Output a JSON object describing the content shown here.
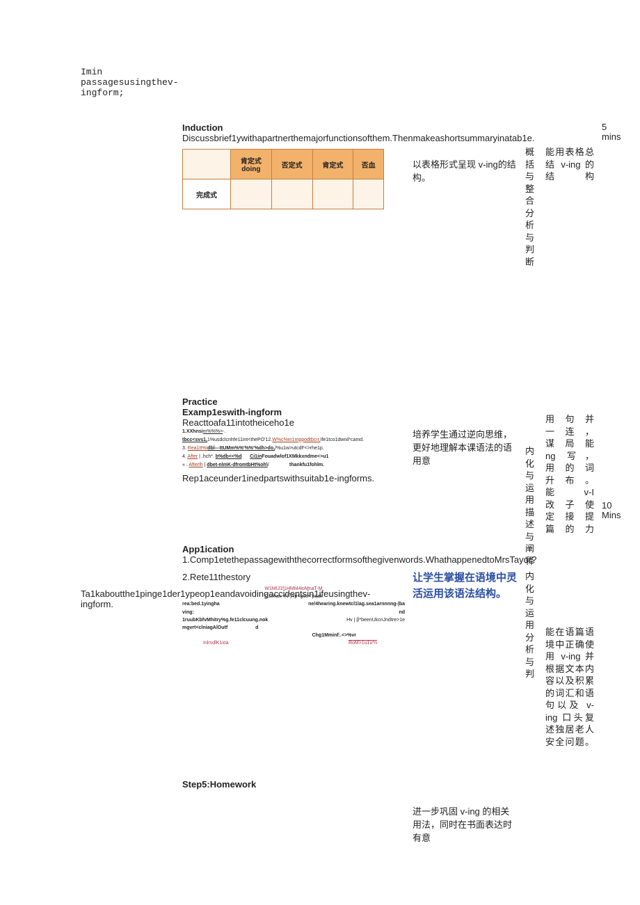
{
  "header": {
    "line1": "Imin",
    "line2": "passagesusingthev-",
    "line3": "ingform;"
  },
  "induction": {
    "title": "Induction",
    "body": "Discussbrief1ywithapartnerthemajorfunctionsofthem.Thenmakeashortsummaryinatab1e.",
    "note": "以表格形式呈现 v-ing的结构。",
    "skill": "概括与整合分析与判断",
    "goal": "能用表格总结 v-ing 的结构",
    "time1": "5",
    "time2": "mins",
    "table": {
      "col1": "肯定式\ndoing",
      "col2": "否定式",
      "col3": "肯定式",
      "col4": "否血",
      "rowlabel": "完成式"
    }
  },
  "practice": {
    "title": "Practice",
    "subtitle": "Examp1eswith-ingform",
    "line1": "Reacttoafa11intotheiceho1e",
    "tiny1": "1.XXhnsi",
    "tiny1u": "m%%%>",
    "tiny1tail": "-.",
    "tiny2a": "tbcc<svs1,",
    "tiny2b": "1%usdclcnhfe11int<thePO'12.",
    "tiny2c": "W%c%m1mppodtbcrr,",
    "tiny2d": "Ife1tco1dwnil*camd.",
    "tiny3a": "3. ",
    "tiny3b": "Rea1tt%i",
    "tiny3c": "dbl---ttUMm%%'%%'%dh>do,",
    "tiny3d": "/%u1w>utcdF<>rhe1p.",
    "tiny4a": "4. ",
    "tiny4b": "After",
    "tiny4c": " | .hch*. ",
    "tiny4d": "b%db<<%d",
    "tiny4e": "Ci1in",
    "tiny4f": "Fouadwlof1XMkkxndme<>u1",
    "tiny5a": "« . ",
    "tiny5b": "Afterlh",
    "tiny5c": " | ",
    "tiny5d": "dbet-nlmK-dfromtbHt%oh\\",
    "tiny5e": "/",
    "tiny5f": "thankfu1fohlm.",
    "line2": "Rep1aceunder1inedpartswithsuitab1e-ingforms.",
    "note": "培养学生通过逆向思维，更好地理解本课语法的语用意",
    "skill": "内化与运用描述与阐释",
    "time1": "10",
    "time2": "Mins",
    "goal1": "用句并",
    "goal2": "一连，",
    "goal3": "谋局能",
    "goal4": "ng 写，",
    "goal5": "用的词",
    "goal6": "升布。",
    "goal7": "能 v-I",
    "goal8": "改子使",
    "goal9": "定接提",
    "goal10": "篇的力"
  },
  "application": {
    "title": "App1ication",
    "line1": "1.Comp1etethepassagewiththecorrectformsofthegivenwords.WhathappenedtoMrsTayor?",
    "line2": "2.Rete11thestory",
    "diag_top": "W1MIJ1f1HMM4ioMnaT-M",
    "diag_climax": "C1imax  ※门*ip<goo<'pcak",
    "diag_l1a": "rea:bed.1yingha",
    "diag_l1b": "ne/4hearing.knewtcl1lag.sea1arnnnng-|ba",
    "diag_l2a": "ving:",
    "diag_l2b": "nd",
    "diag_l3a": "1ruubKbfvMhitry%g.fe11clcuung.nok",
    "diag_l3b": "Hv | β*beenUkcnJndtre>1e",
    "diag_l4a": "mgvrt<clniagAlOutf",
    "diag_l4b": "d",
    "diag_l5": "Chg1Mminf:.<>%vr",
    "diag_l6a": "InlrvdlK1ioa",
    "diag_l6b": "RoM>1u1u*n",
    "mainnote": "让学生掌握在语境中灵活运用该语法结构。",
    "skill": "内化与运用分析与判",
    "goal": "能在语篇语境中正确使用 v-ing 并根据文本内容以及积累的词汇和语句以及 v-ing 口头复述独居老人安全问题。"
  },
  "leftblock": {
    "text": "Ta1kaboutthe1pinge1der1ypeop1eandavoidingaccidentsin1ifeusingthev-ingform."
  },
  "homework": {
    "title": "Step5:Homework",
    "note": "进一步巩固 v-ing 的相关用法，同时在书面表达时有意"
  }
}
